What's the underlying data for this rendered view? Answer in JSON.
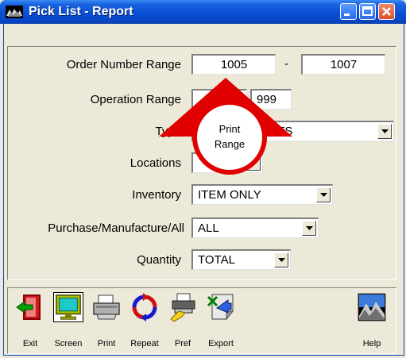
{
  "window": {
    "title": "Pick List - Report"
  },
  "form": {
    "order_number_range": {
      "label": "Order Number Range",
      "from": "1005",
      "separator": "-",
      "to": "1007"
    },
    "operation_range": {
      "label": "Operation Range",
      "from": "",
      "to": "999"
    },
    "type": {
      "label": "Type",
      "value": "ITS"
    },
    "locations": {
      "label": "Locations",
      "value": ""
    },
    "inventory": {
      "label": "Inventory",
      "value": "ITEM ONLY"
    },
    "purchase_manufacture_all": {
      "label": "Purchase/Manufacture/All",
      "value": "ALL"
    },
    "quantity": {
      "label": "Quantity",
      "value": "TOTAL"
    }
  },
  "callout": {
    "line1": "Print",
    "line2": "Range"
  },
  "toolbar": {
    "exit": "Exit",
    "screen": "Screen",
    "print": "Print",
    "repeat": "Repeat",
    "pref": "Pref",
    "export": "Export",
    "help": "Help"
  },
  "colors": {
    "title_bar": "#0a4fd6",
    "callout_red": "#e00000",
    "face": "#ece9d8"
  }
}
